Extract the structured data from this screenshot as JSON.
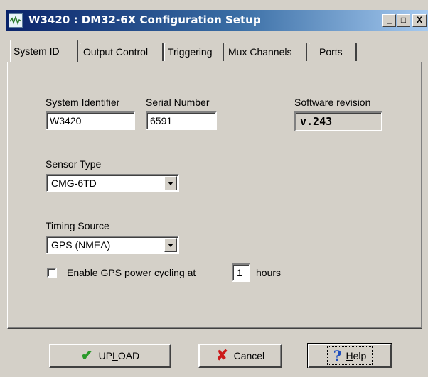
{
  "window": {
    "title": "W3420 : DM32-6X Configuration Setup"
  },
  "tabs": [
    {
      "label": "System ID",
      "active": true
    },
    {
      "label": "Output Control",
      "active": false
    },
    {
      "label": "Triggering",
      "active": false
    },
    {
      "label": "Mux Channels",
      "active": false
    },
    {
      "label": "Ports",
      "active": false
    }
  ],
  "system_id": {
    "system_identifier_label": "System Identifier",
    "system_identifier_value": "W3420",
    "serial_number_label": "Serial Number",
    "serial_number_value": "6591",
    "software_revision_label": "Software revision",
    "software_revision_value": "v.243",
    "sensor_type_label": "Sensor Type",
    "sensor_type_value": "CMG-6TD",
    "timing_source_label": "Timing Source",
    "timing_source_value": "GPS (NMEA)",
    "gps_power_cycling_label": "Enable GPS power cycling at",
    "gps_power_cycling_checked": false,
    "gps_power_cycling_hours": "1",
    "gps_power_cycling_unit": "hours"
  },
  "buttons": {
    "upload_label_pre": "UP",
    "upload_label_underlined": "L",
    "upload_label_post": "OAD",
    "cancel_label": "Cancel",
    "help_label_underlined": "H",
    "help_label_post": "elp"
  },
  "titlebar_buttons": {
    "minimize": "_",
    "maximize": "□",
    "close": "X"
  },
  "icons": {
    "upload": "check-mark-icon",
    "cancel": "red-x-icon",
    "help": "question-mark-icon"
  },
  "colors": {
    "titlebar_start": "#0a246a",
    "titlebar_end": "#a6caf0",
    "dialog_face": "#d4d0c8",
    "check_green": "#2a9a2a",
    "cancel_red": "#cc1a1a",
    "help_blue": "#1f4fbf"
  }
}
